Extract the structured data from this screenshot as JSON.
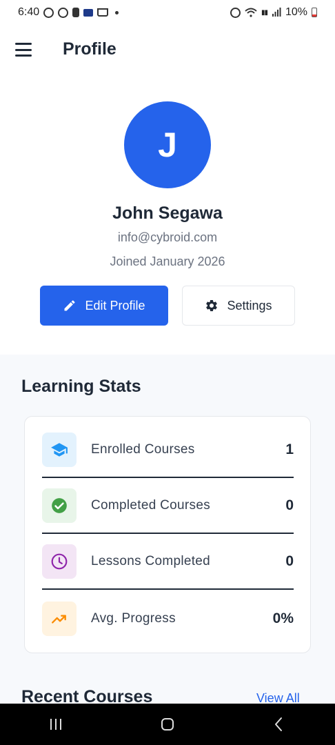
{
  "status_bar": {
    "time": "6:40",
    "battery_percent": "10%",
    "icons": [
      "whatsapp-icon",
      "whatsapp-icon",
      "alert-icon",
      "card-icon",
      "cart-icon",
      "dot-icon",
      "alarm-icon",
      "wifi-icon",
      "volte-icon",
      "signal-icon",
      "battery-icon"
    ]
  },
  "app_bar": {
    "title": "Profile",
    "menu_icon": "menu-icon"
  },
  "profile": {
    "avatar_initial": "J",
    "name": "John Segawa",
    "email": "info@cybroid.com",
    "joined": "Joined January 2026",
    "avatar_color": "#2563eb"
  },
  "actions": {
    "edit_label": "Edit Profile",
    "edit_icon": "pencil-icon",
    "settings_label": "Settings",
    "settings_icon": "gear-icon"
  },
  "stats": {
    "title": "Learning Stats",
    "items": [
      {
        "label": "Enrolled Courses",
        "value": "1",
        "icon": "graduation-cap-icon",
        "color": "#2196f3",
        "bg": "#e3f2fd"
      },
      {
        "label": "Completed Courses",
        "value": "0",
        "icon": "check-circle-icon",
        "color": "#43a047",
        "bg": "#e8f5e9"
      },
      {
        "label": "Lessons Completed",
        "value": "0",
        "icon": "clock-icon",
        "color": "#8e24aa",
        "bg": "#f3e5f5"
      },
      {
        "label": "Avg. Progress",
        "value": "0%",
        "icon": "trending-up-icon",
        "color": "#fb8c00",
        "bg": "#fff3e0"
      }
    ]
  },
  "recent": {
    "title": "Recent Courses",
    "view_all": "View All"
  },
  "nav_bar": {
    "icons": [
      "recents-icon",
      "home-icon",
      "back-icon"
    ]
  }
}
